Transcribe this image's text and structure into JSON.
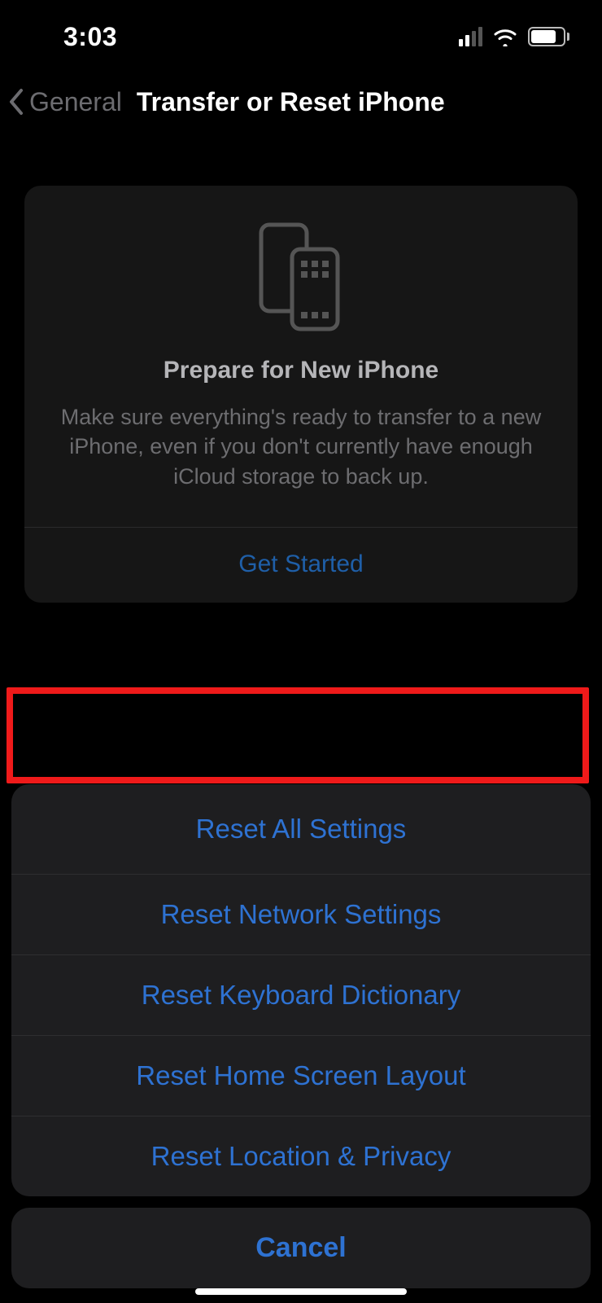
{
  "status": {
    "time": "3:03"
  },
  "nav": {
    "back_label": "General",
    "title": "Transfer or Reset iPhone"
  },
  "card": {
    "title": "Prepare for New iPhone",
    "description": "Make sure everything's ready to transfer to a new iPhone, even if you don't currently have enough iCloud storage to back up.",
    "action_label": "Get Started"
  },
  "sheet": {
    "options": [
      "Reset All Settings",
      "Reset Network Settings",
      "Reset Keyboard Dictionary",
      "Reset Home Screen Layout",
      "Reset Location & Privacy"
    ],
    "cancel_label": "Cancel"
  },
  "highlight": {
    "target_option_index": 0
  }
}
